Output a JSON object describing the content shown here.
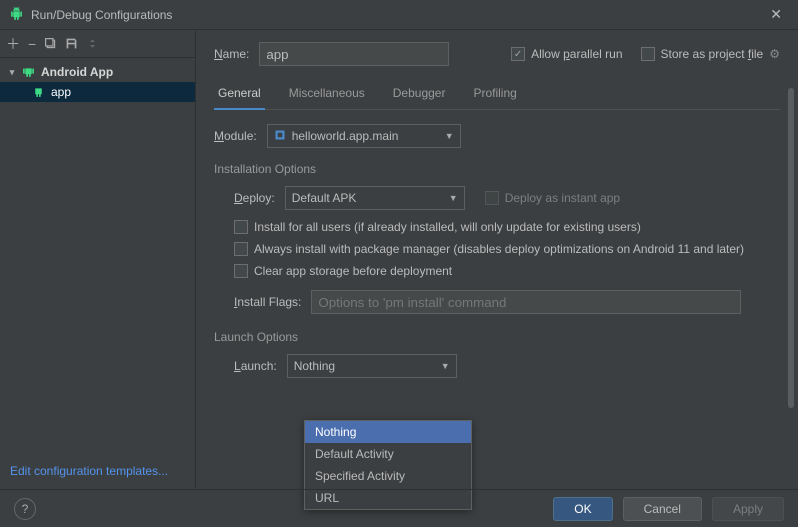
{
  "window": {
    "title": "Run/Debug Configurations"
  },
  "sidebar": {
    "category": "Android App",
    "item": "app",
    "edit_templates": "Edit configuration templates..."
  },
  "header": {
    "name_label_pre": "N",
    "name_label_post": "ame:",
    "name_value": "app",
    "allow_parallel_pre": "Allow ",
    "allow_parallel_u": "p",
    "allow_parallel_post": "arallel run",
    "store_pre": "Store as project ",
    "store_u": "f",
    "store_post": "ile"
  },
  "tabs": {
    "general": "General",
    "misc": "Miscellaneous",
    "debugger": "Debugger",
    "profiling": "Profiling"
  },
  "module": {
    "label_u": "M",
    "label_post": "odule:",
    "value": "helloworld.app.main"
  },
  "install": {
    "section": "Installation Options",
    "deploy_u": "D",
    "deploy_post": "eploy:",
    "deploy_value": "Default APK",
    "instant": "Deploy as instant app",
    "all_users": "Install for all users (if already installed, will only update for existing users)",
    "pkg_mgr": "Always install with package manager (disables deploy optimizations on Android 11 and later)",
    "clear_storage": "Clear app storage before deployment",
    "flags_u": "I",
    "flags_post": "nstall Flags:",
    "flags_placeholder": "Options to 'pm install' command"
  },
  "launch": {
    "section": "Launch Options",
    "label_u": "L",
    "label_post": "aunch:",
    "value": "Nothing",
    "options": [
      "Nothing",
      "Default Activity",
      "Specified Activity",
      "URL"
    ]
  },
  "footer": {
    "ok": "OK",
    "cancel": "Cancel",
    "apply": "Apply"
  }
}
